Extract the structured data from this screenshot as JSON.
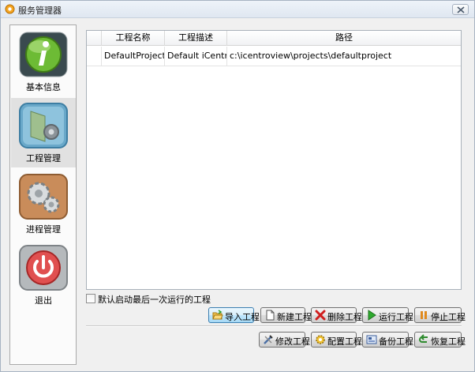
{
  "window": {
    "title": "服务管理器"
  },
  "sidebar": {
    "items": [
      {
        "label": "基本信息",
        "icon": "info-icon"
      },
      {
        "label": "工程管理",
        "icon": "project-folder-icon",
        "active": true
      },
      {
        "label": "进程管理",
        "icon": "gears-icon"
      },
      {
        "label": "退出",
        "icon": "power-icon"
      }
    ]
  },
  "table": {
    "columns": [
      "工程名称",
      "工程描述",
      "路径"
    ],
    "rows": [
      {
        "name": "DefaultProject",
        "description": "Default iCentr...",
        "path": "c:\\icentroview\\projects\\defaultproject"
      }
    ]
  },
  "options": {
    "autostart_label": "默认启动最后一次运行的工程",
    "autostart_checked": false
  },
  "buttons": {
    "import": "导入工程",
    "new": "新建工程",
    "delete": "删除工程",
    "run": "运行工程",
    "stop": "停止工程",
    "modify": "修改工程",
    "configure": "配置工程",
    "backup": "备份工程",
    "restore": "恢复工程"
  },
  "colors": {
    "info_green": "#5fae2a",
    "power_red": "#d23b3b",
    "active_bg": "#e1e1e1",
    "focus_blue": "#3c7fb1"
  }
}
